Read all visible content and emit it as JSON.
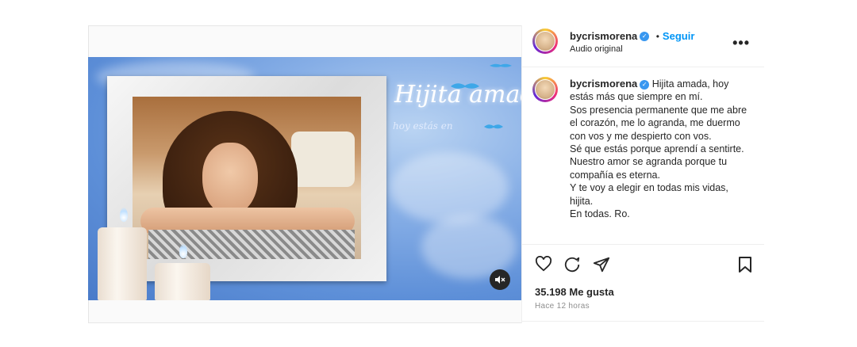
{
  "post": {
    "username": "bycrismorena",
    "follow_label": "Seguir",
    "audio_label": "Audio original",
    "more_icon": "more-horizontal-icon",
    "verified_icon": "verified-badge-icon"
  },
  "media": {
    "overlay_title": "Hijita amada",
    "overlay_subtitle": "hoy estás en",
    "mute_icon": "speaker-muted-icon"
  },
  "caption": {
    "username": "bycrismorena",
    "lines": [
      "Hijita amada, hoy estás más que siempre en mí.",
      "Sos presencia permanente que me abre el corazón, me lo agranda, me duermo con vos y me despierto con vos.",
      "Sé que estás porque aprendí a sentirte.",
      "Nuestro amor se agranda porque tu compañía es eterna.",
      "Y te voy a elegir en todas mis vidas, hijita.",
      "En todas. Ro."
    ]
  },
  "actions": {
    "like_icon": "heart-icon",
    "comment_icon": "comment-icon",
    "share_icon": "share-icon",
    "save_icon": "bookmark-icon",
    "likes_text": "35.198 Me gusta",
    "time_text": "Hace 12 horas"
  },
  "colors": {
    "accent": "#0095f6",
    "verified": "#3897f0",
    "text": "#262626",
    "muted": "#8e8e8e"
  }
}
